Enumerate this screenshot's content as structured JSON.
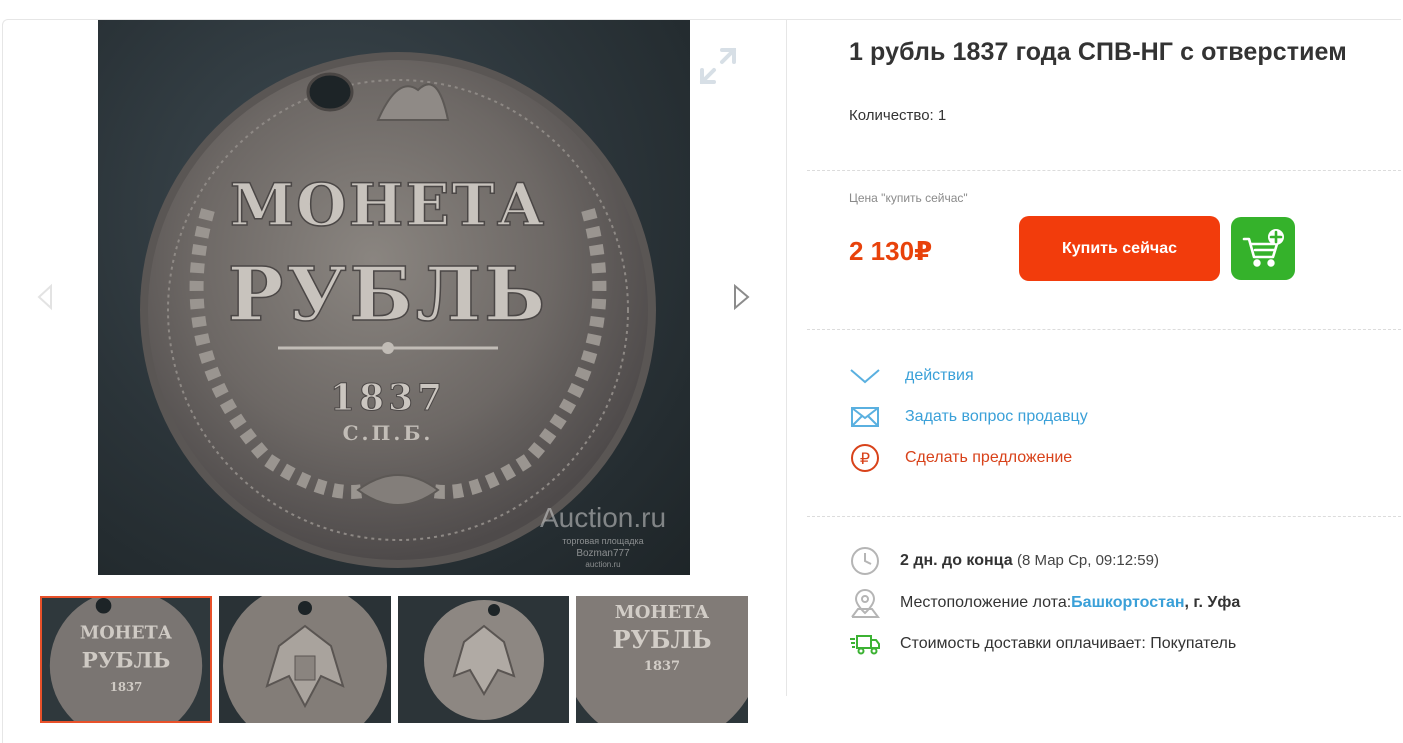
{
  "lot": {
    "title": "1 рубль 1837 года СПВ-НГ с отверстием",
    "quantity_label": "Количество: 1"
  },
  "price": {
    "label": "Цена \"купить сейчас\"",
    "amount": "2 130₽"
  },
  "buttons": {
    "buy_now": "Купить сейчас",
    "add_to_cart_icon": "cart-plus-icon"
  },
  "actions": [
    {
      "label": "действия",
      "icon": "chevron-down-icon"
    },
    {
      "label": "Задать вопрос продавцу",
      "icon": "envelope-icon"
    },
    {
      "label": "Сделать предложение",
      "icon": "ruble-circle-icon"
    }
  ],
  "info": {
    "time_left": "2 дн. до конца",
    "end_date": "(8 Мар Ср, 09:12:59)",
    "location_label": "Местоположение лота:",
    "location_region": "Башкортостан",
    "location_city": ", г. Уфа",
    "shipping": "Стоимость доставки оплачивает: Покупатель"
  },
  "gallery": {
    "coin_text": {
      "word1": "МОНЕТА",
      "word2": "РУБЛЬ",
      "year": "1837",
      "mint": "С.П.Б."
    },
    "watermark": {
      "brand": "Auction.ru",
      "line1": "торговая площадка",
      "line2": "Bozman777",
      "line3": "auction.ru"
    },
    "thumbnails": [
      {
        "alt": "reverse"
      },
      {
        "alt": "obverse eagle"
      },
      {
        "alt": "obverse full"
      },
      {
        "alt": "reverse closeup"
      }
    ]
  },
  "colors": {
    "accent_red": "#f23c0c",
    "price_red": "#e8420b",
    "cart_green": "#35b22b",
    "link_blue": "#3aa0d8"
  }
}
